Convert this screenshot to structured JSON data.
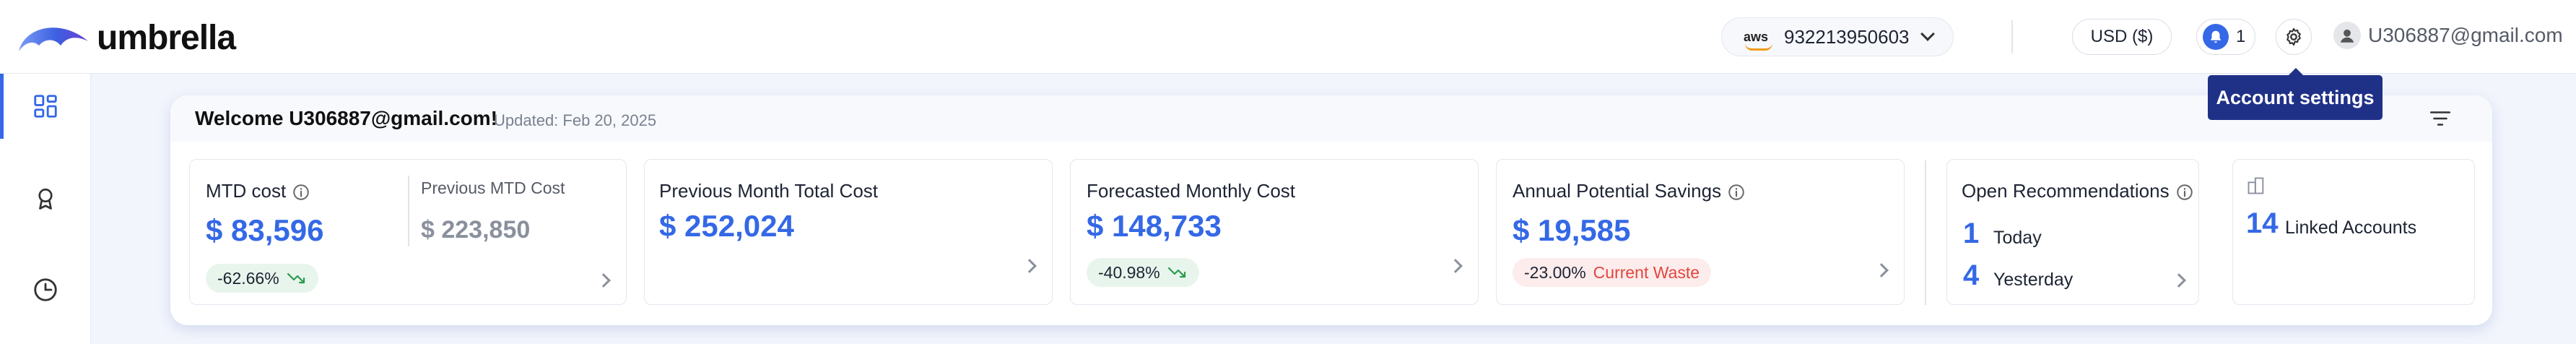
{
  "brand": {
    "name": "umbrella"
  },
  "header": {
    "account_id": "932213950603",
    "account_provider": "aws",
    "currency": "USD ($)",
    "notification_count": "1",
    "user_email": "U306887@gmail.com",
    "tooltip": "Account settings"
  },
  "sidebar": {
    "items": [
      {
        "icon": "dashboard-icon",
        "active": true
      },
      {
        "icon": "award-ribbon-icon",
        "active": false
      },
      {
        "icon": "clock-icon",
        "active": false
      }
    ]
  },
  "panel": {
    "welcome": "Welcome U306887@gmail.com!",
    "updated": "Updated: Feb 20, 2025"
  },
  "cards": {
    "mtd": {
      "title": "MTD cost",
      "value": "$ 83,596",
      "change": "-62.66%",
      "prev_label": "Previous MTD Cost",
      "prev_value": "$ 223,850"
    },
    "prev_month": {
      "title": "Previous Month Total Cost",
      "value": "$ 252,024"
    },
    "forecast": {
      "title": "Forecasted Monthly Cost",
      "value": "$ 148,733",
      "change": "-40.98%"
    },
    "savings": {
      "title": "Annual Potential Savings",
      "value": "$ 19,585",
      "change": "-23.00%",
      "change_label": "Current Waste"
    },
    "recommendations": {
      "title": "Open Recommendations",
      "today_count": "1",
      "today_label": "Today",
      "yesterday_count": "4",
      "yesterday_label": "Yesterday"
    },
    "linked": {
      "count": "14",
      "label": "Linked Accounts"
    }
  },
  "colors": {
    "accent": "#3468e6",
    "tooltip_bg": "#1f3187",
    "waste": "#e0473e",
    "trend_down": "#2e9b4f"
  }
}
